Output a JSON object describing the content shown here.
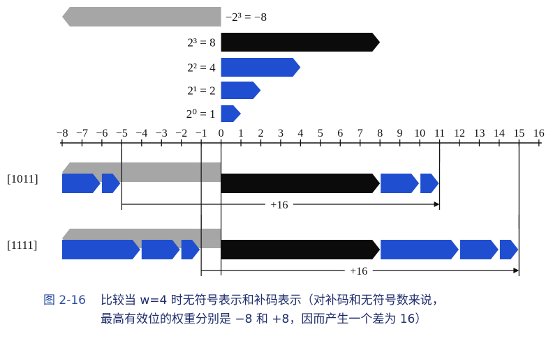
{
  "figure": {
    "number": "图 2-16",
    "caption_line1": "比较当 w=4 时无符号表示和补码表示（对补码和无符号数来说，",
    "caption_line2": "最高有效位的权重分别是 −8 和 +8，因而产生一个差为 16）"
  },
  "colors": {
    "negative_bar": "#a6a6a6",
    "bit3_bar": "#0b0b0b",
    "blue_bar": "#1f4fd0",
    "axis": "#111111",
    "text": "#111111",
    "caption_text": "#1f2d6b"
  },
  "weights_legend": [
    {
      "label": "−2³ = −8",
      "value": -8,
      "color_key": "negative_bar",
      "label_side": "right"
    },
    {
      "label": "2³ = 8",
      "value": 8,
      "color_key": "bit3_bar",
      "label_side": "left"
    },
    {
      "label": "2² = 4",
      "value": 4,
      "color_key": "blue_bar",
      "label_side": "left"
    },
    {
      "label": "2¹ = 2",
      "value": 2,
      "color_key": "blue_bar",
      "label_side": "left"
    },
    {
      "label": "2⁰ = 1",
      "value": 1,
      "color_key": "blue_bar",
      "label_side": "left"
    }
  ],
  "number_line": {
    "min": -8,
    "max": 16,
    "ticks": [
      "−8",
      "−7",
      "−6",
      "−5",
      "−4",
      "−3",
      "−2",
      "−1",
      "0",
      "1",
      "2",
      "3",
      "4",
      "5",
      "6",
      "7",
      "8",
      "9",
      "10",
      "11",
      "12",
      "13",
      "14",
      "15",
      "16"
    ]
  },
  "examples": [
    {
      "label": "[1011]",
      "negative_segment": [
        -8,
        0
      ],
      "negative_blue_segments": [
        [
          -8,
          -6
        ],
        [
          -6,
          -5
        ]
      ],
      "positive_black_segment": [
        0,
        8
      ],
      "positive_blue_segments": [
        [
          8,
          10
        ],
        [
          10,
          11
        ]
      ],
      "twos_complement_value": -5,
      "unsigned_value": 11,
      "difference_label": "+16"
    },
    {
      "label": "[1111]",
      "negative_segment": [
        -8,
        0
      ],
      "negative_blue_segments": [
        [
          -8,
          -4
        ],
        [
          -4,
          -2
        ],
        [
          -2,
          -1
        ]
      ],
      "positive_black_segment": [
        0,
        8
      ],
      "positive_blue_segments": [
        [
          8,
          12
        ],
        [
          12,
          14
        ],
        [
          14,
          15
        ]
      ],
      "twos_complement_value": -1,
      "unsigned_value": 15,
      "difference_label": "+16"
    }
  ]
}
